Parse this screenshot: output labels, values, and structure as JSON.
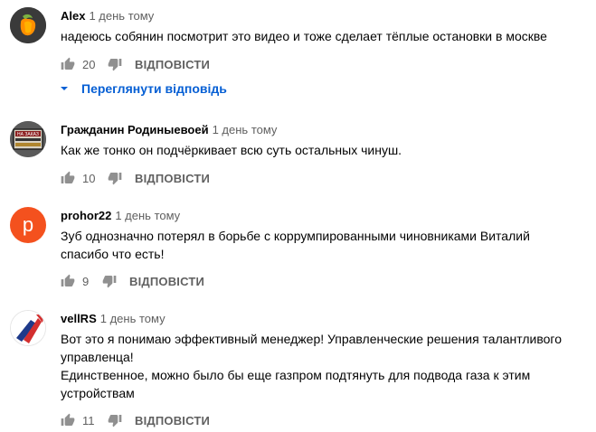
{
  "reply_label": "ВІДПОВІСТИ",
  "view_replies_label": "Переглянути відповідь",
  "comments": [
    {
      "author": "Alex",
      "time": "1 день тому",
      "lines": [
        "надеюсь собянин посмотрит это видео и тоже сделает тёплые остановки в москве"
      ],
      "likes": "20",
      "avatar_icon": "fl-studio-fruit-logo-icon"
    },
    {
      "author": "Гражданин Родиныевоей",
      "time": "1 день тому",
      "lines": [
        "Как же тонко он подчёркивает всю суть остальных чинуш."
      ],
      "likes": "10",
      "avatar_icon": "flag-badge-avatar-icon"
    },
    {
      "author": "prohor22",
      "time": "1 день тому",
      "lines": [
        "Зуб однозначно потерял в борьбе с коррумпированными чиновниками Виталий",
        "спасибо что есть!"
      ],
      "likes": "9",
      "avatar_letter": "p",
      "avatar_color": "#f4511e"
    },
    {
      "author": "vellRS",
      "time": "1 день тому",
      "lines": [
        "Вот это я понимаю эффективный менеджер! Управленческие решения талантливого",
        "управленца!",
        "Единственное, можно было бы еще газпром подтянуть для подвода газа к этим",
        "устройствам"
      ],
      "likes": "11",
      "avatar_icon": "red-arrow-logo-icon"
    }
  ],
  "colors": {
    "link": "#065fd4",
    "secondary_text": "#606060",
    "icon": "#909090"
  }
}
